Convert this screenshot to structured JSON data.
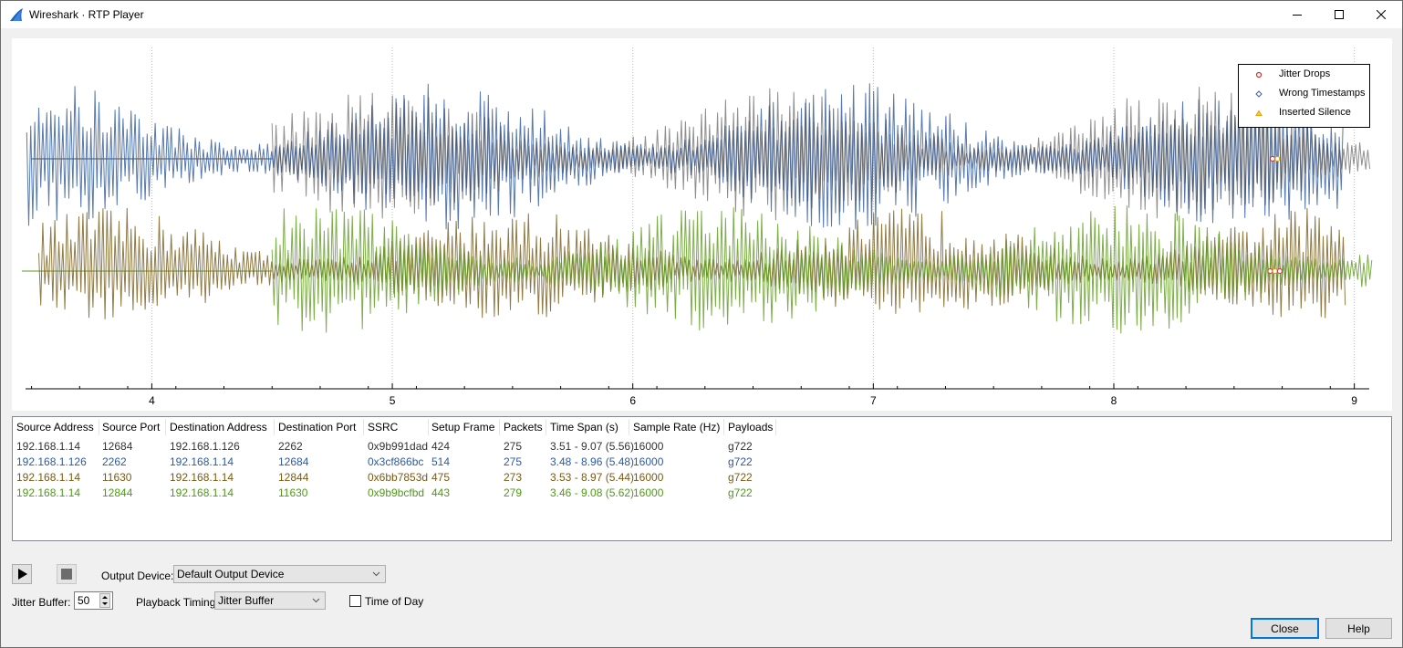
{
  "window": {
    "title": "Wireshark · RTP Player",
    "icon": "wireshark-fin-icon",
    "controls": [
      "minimize-icon",
      "maximize-icon",
      "close-icon"
    ]
  },
  "colors": {
    "stream1": "#444444",
    "stream2": "#3a62a0",
    "stream3": "#7c6426",
    "stream4": "#5c9a1c",
    "jitter_drops": "#d0302a",
    "wrong_timestamps": "#3a62a0",
    "inserted_silence": "#e0a000"
  },
  "plot": {
    "x_ticks": [
      "4",
      "5",
      "6",
      "7",
      "8",
      "9"
    ],
    "x_range": [
      3.475,
      9.1
    ],
    "legend": [
      {
        "label": "Jitter Drops",
        "marker": "circle",
        "color": "#d0302a"
      },
      {
        "label": "Wrong Timestamps",
        "marker": "diamond",
        "color": "#3a62a0"
      },
      {
        "label": "Inserted Silence",
        "marker": "triangle",
        "color": "#e0a000"
      }
    ]
  },
  "table": {
    "columns": [
      "Source Address",
      "Source Port",
      "Destination Address",
      "Destination Port",
      "SSRC",
      "Setup Frame",
      "Packets",
      "Time Span (s)",
      "Sample Rate (Hz)",
      "Payloads"
    ],
    "rows": [
      {
        "color": "#333333",
        "cells": [
          "192.168.1.14",
          "12684",
          "192.168.1.126",
          "2262",
          "0x9b991dad",
          "424",
          "275",
          "3.51 - 9.07 (5.56)",
          "16000",
          "g722"
        ]
      },
      {
        "color": "#2d5aa0",
        "cells": [
          "192.168.1.126",
          "2262",
          "192.168.1.14",
          "12684",
          "0x3cf866bc",
          "514",
          "275",
          "3.48 - 8.96 (5.48)",
          "16000",
          "g722"
        ]
      },
      {
        "color": "#7a5a14",
        "cells": [
          "192.168.1.14",
          "11630",
          "192.168.1.14",
          "12844",
          "0x6bb7853d",
          "475",
          "273",
          "3.53 - 8.97 (5.44)",
          "16000",
          "g722"
        ]
      },
      {
        "color": "#4e9a16",
        "cells": [
          "192.168.1.14",
          "12844",
          "192.168.1.14",
          "11630",
          "0x9b9bcfbd",
          "443",
          "279",
          "3.46 - 9.08 (5.62)",
          "16000",
          "g722"
        ]
      }
    ]
  },
  "controls": {
    "play_icon": "play-icon",
    "stop_icon": "stop-icon",
    "output_device_label": "Output Device:",
    "output_device_value": "Default Output Device",
    "jitter_buffer_label": "Jitter Buffer:",
    "jitter_buffer_value": "50",
    "playback_timing_label": "Playback Timing:",
    "playback_timing_value": "Jitter Buffer",
    "time_of_day_label": "Time of Day",
    "time_of_day_checked": false
  },
  "buttons": {
    "close": "Close",
    "help": "Help"
  }
}
